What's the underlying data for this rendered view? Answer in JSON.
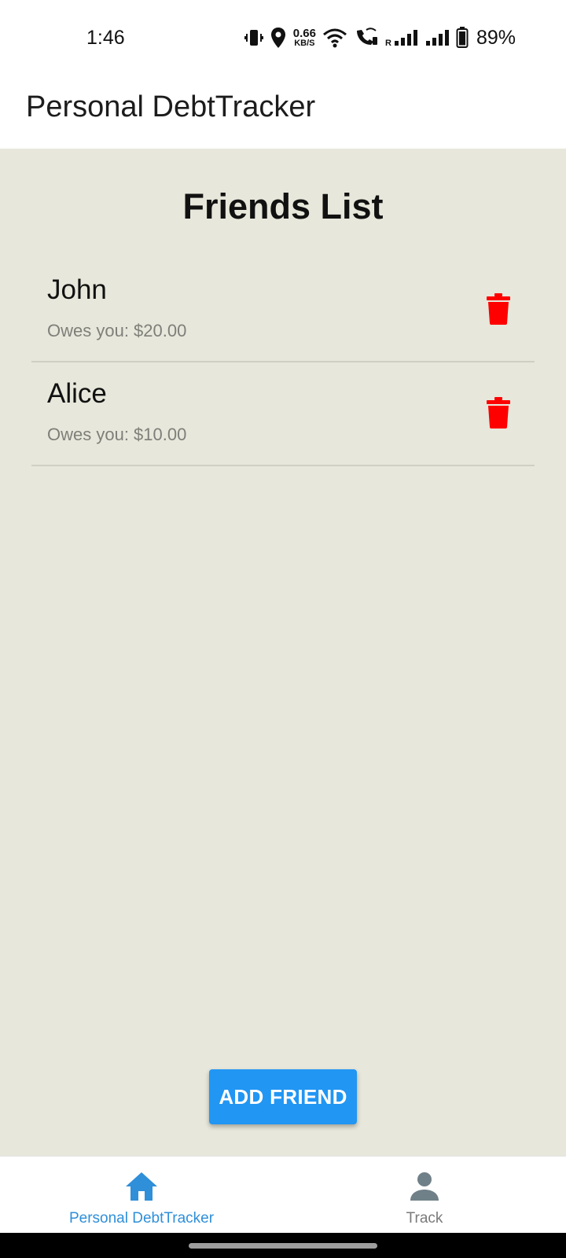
{
  "status_bar": {
    "time": "1:46",
    "net_speed_value": "0.66",
    "net_speed_unit": "KB/S",
    "battery_percent": "89%"
  },
  "app_bar": {
    "title": "Personal DebtTracker"
  },
  "main": {
    "title": "Friends List",
    "friends": [
      {
        "name": "John",
        "owes": "Owes you: $20.00"
      },
      {
        "name": "Alice",
        "owes": "Owes you: $10.00"
      }
    ],
    "add_button_label": "ADD FRIEND"
  },
  "bottom_nav": {
    "items": [
      {
        "label": "Personal DebtTracker",
        "icon": "home-icon",
        "active": true
      },
      {
        "label": "Track",
        "icon": "person-icon",
        "active": false
      }
    ]
  },
  "colors": {
    "accent": "#2196f3",
    "content_background": "#e7e7db",
    "delete_icon": "#ff0000",
    "nav_active": "#2f8fd8",
    "nav_inactive": "#7a7a7a"
  }
}
